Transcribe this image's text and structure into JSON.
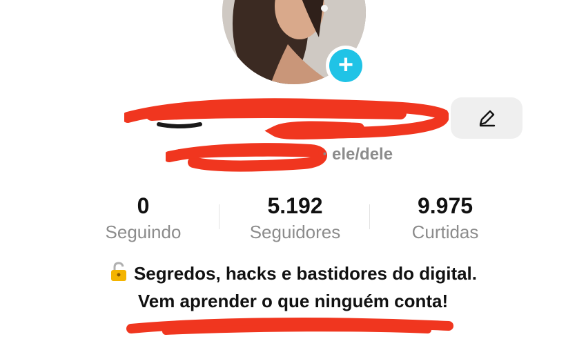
{
  "profile": {
    "pronouns": "ele/dele",
    "pronoun_separator": "·",
    "stats": [
      {
        "value": "0",
        "label": "Seguindo"
      },
      {
        "value": "5.192",
        "label": "Seguidores"
      },
      {
        "value": "9.975",
        "label": "Curtidas"
      }
    ],
    "bio_line_1": "Segredos, hacks e bastidores do digital.",
    "bio_line_2": "Vem aprender o que ninguém conta!",
    "add_symbol": "+"
  },
  "colors": {
    "accent": "#20c3e6",
    "redaction": "#f0361f",
    "muted_text": "#8c8c8c"
  },
  "icons": [
    "plus-icon",
    "pencil-icon",
    "lock-icon"
  ]
}
